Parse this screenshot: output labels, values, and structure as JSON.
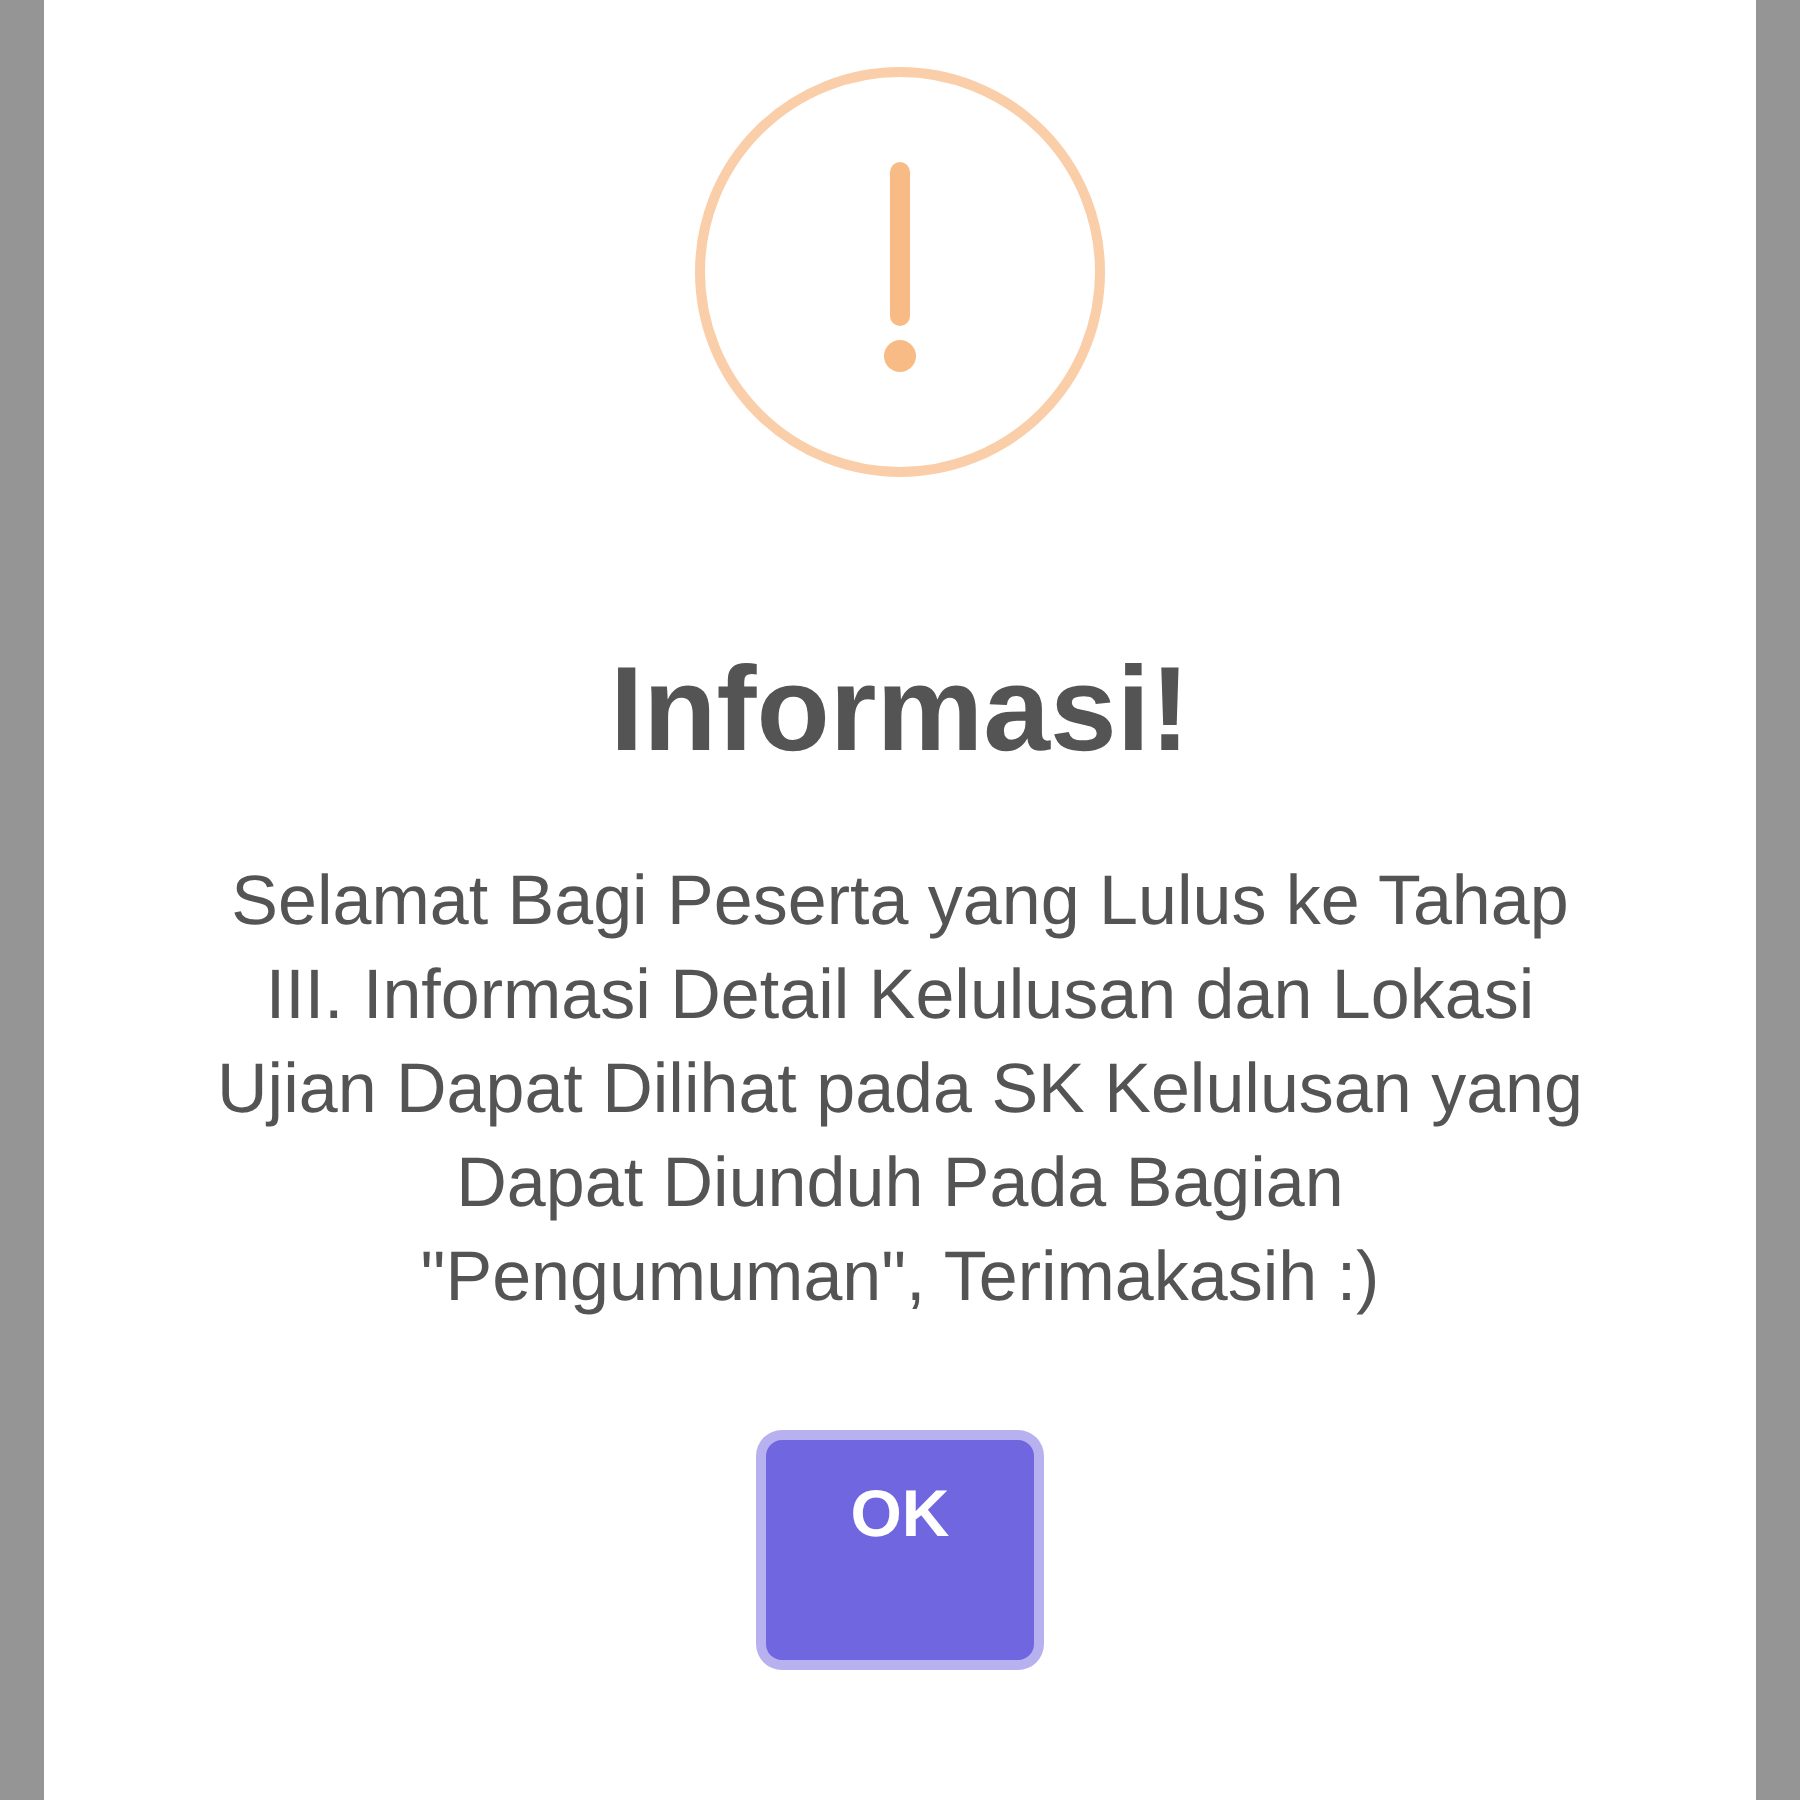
{
  "dialog": {
    "icon": {
      "kind": "warning"
    },
    "title": "Informasi!",
    "message": "Selamat Bagi Peserta yang Lulus ke Tahap III. Informasi Detail Kelulusan dan Lokasi Ujian Dapat Dilihat pada SK Kelulusan yang Dapat Diunduh Pada Bagian \"Pengumuman\", Terimakasih :)",
    "buttons": [
      {
        "label": "OK",
        "focused": true
      }
    ]
  }
}
